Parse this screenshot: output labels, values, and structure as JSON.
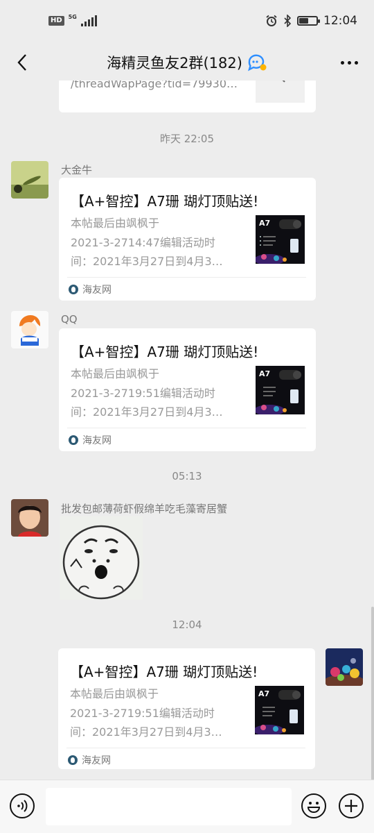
{
  "status_bar": {
    "hd_badge": "HD",
    "network": "5G",
    "time": "12:04"
  },
  "header": {
    "title": "海精灵鱼友2群(182)"
  },
  "messages": {
    "partial_top_link": "/threadWapPage?tid=79930…",
    "time_1": "昨天 22:05",
    "msg1": {
      "sender": "大金牛",
      "card_title": "【A+智控】A7珊 瑚灯顶贴送!",
      "desc_lines": [
        "本帖最后由飒枫于",
        "2021-3-2714:47编辑活动时",
        "间：2021年3月27日到4月3…"
      ],
      "thumb_label": "A7",
      "source": "海友网"
    },
    "msg2": {
      "sender": "QQ",
      "card_title": "【A+智控】A7珊 瑚灯顶贴送!",
      "desc_lines": [
        "本帖最后由飒枫于",
        "2021-3-2719:51编辑活动时",
        "间：2021年3月27日到4月3…"
      ],
      "thumb_label": "A7",
      "source": "海友网"
    },
    "time_2": "05:13",
    "msg3": {
      "sender": "批发包邮薄荷虾假绵羊吃毛藻寄居蟹"
    },
    "time_3": "12:04",
    "msg4": {
      "card_title": "【A+智控】A7珊 瑚灯顶贴送!",
      "desc_lines": [
        "本帖最后由飒枫于",
        "2021-3-2719:51编辑活动时",
        "间：2021年3月27日到4月3…"
      ],
      "thumb_label": "A7",
      "source": "海友网"
    }
  },
  "input_bar": {
    "placeholder": ""
  },
  "colors": {
    "background": "#ededed",
    "card": "#ffffff",
    "muted_text": "#999999",
    "brand_icon": "#2d5a74"
  },
  "icons": {
    "back": "chevron-left-icon",
    "group_badge": "chat-bubble-icon",
    "more": "more-dots-icon",
    "voice": "voice-icon",
    "emoji": "emoji-icon",
    "plus": "plus-icon",
    "alarm": "alarm-icon",
    "bluetooth": "bluetooth-icon",
    "battery": "battery-icon"
  },
  "battery_level": 0.55
}
